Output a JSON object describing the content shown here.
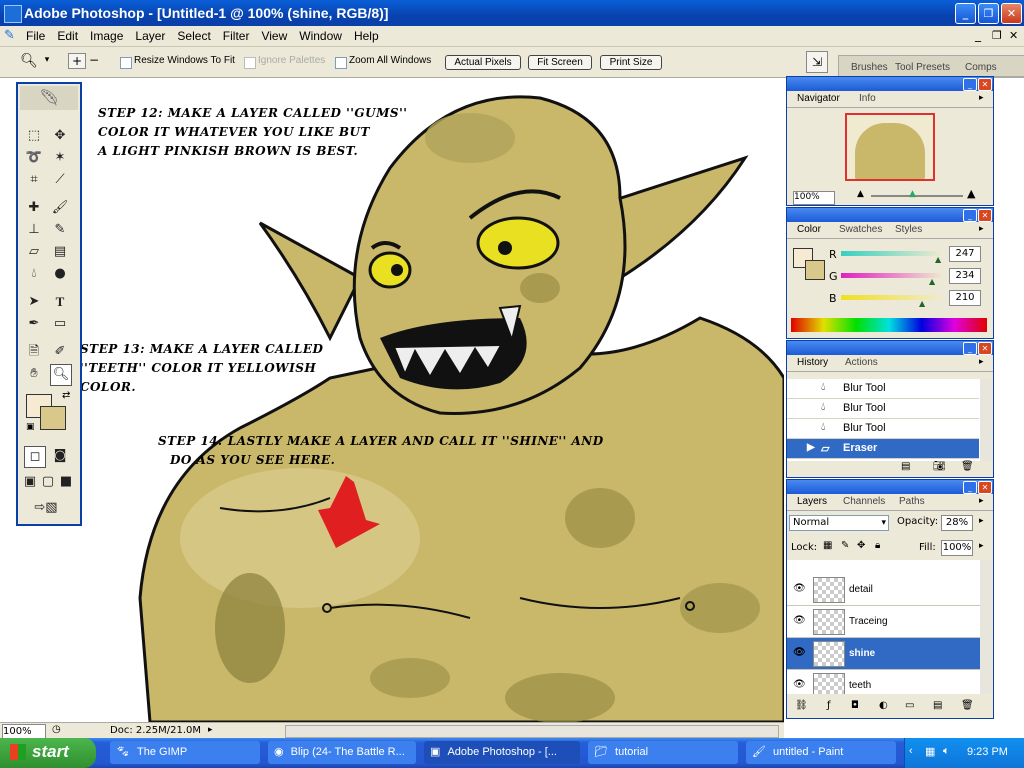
{
  "app": {
    "title": "Adobe Photoshop - [Untitled-1 @ 100% (shine, RGB/8)]",
    "accent": "#0a5fd8"
  },
  "menus": [
    "File",
    "Edit",
    "Image",
    "Layer",
    "Select",
    "Filter",
    "View",
    "Window",
    "Help"
  ],
  "options": {
    "resize_windows": "Resize Windows To Fit",
    "ignore_palettes": "Ignore Palettes",
    "zoom_all": "Zoom All Windows",
    "actual_pixels": "Actual Pixels",
    "fit_screen": "Fit Screen",
    "print_size": "Print Size",
    "dock_tabs": [
      "Brushes",
      "Tool Presets",
      "Comps"
    ]
  },
  "canvas": {
    "step12_line1": "Step 12: Make a layer called ''Gums''",
    "step12_line2": "color it whatever you like but",
    "step12_line3": "a light pinkish brown is best.",
    "step13_line1": "Step 13: Make a layer called",
    "step13_line2": "''Teeth'' color it yellowish",
    "step13_line3": "color.",
    "step14_line1": "Step 14: Lastly make a layer and call it ''Shine'' and",
    "step14_line2": "do as you see here.",
    "skin_color": "#c9b76a",
    "arrow_color": "#e02020"
  },
  "navigator": {
    "tabs": [
      "Navigator",
      "Info"
    ],
    "zoom": "100%"
  },
  "color_panel": {
    "tabs": [
      "Color",
      "Swatches",
      "Styles"
    ],
    "r_label": "R",
    "g_label": "G",
    "b_label": "B",
    "r": "247",
    "g": "234",
    "b": "210"
  },
  "history": {
    "tabs": [
      "History",
      "Actions"
    ],
    "items": [
      "Blur Tool",
      "Blur Tool",
      "Blur Tool",
      "Eraser"
    ]
  },
  "layers": {
    "tabs": [
      "Layers",
      "Channels",
      "Paths"
    ],
    "blend_mode": "Normal",
    "opacity_label": "Opacity:",
    "opacity": "28%",
    "lock_label": "Lock:",
    "fill_label": "Fill:",
    "fill": "100%",
    "items": [
      "detail",
      "Traceing",
      "shine",
      "teeth"
    ]
  },
  "status": {
    "zoom": "100%",
    "doc": "Doc: 2.25M/21.0M"
  },
  "taskbar": {
    "start": "start",
    "tasks": [
      "The GIMP",
      "Blip (24- The Battle R...",
      "Adobe Photoshop - [...",
      "tutorial",
      "untitled - Paint"
    ],
    "clock": "9:23 PM"
  }
}
